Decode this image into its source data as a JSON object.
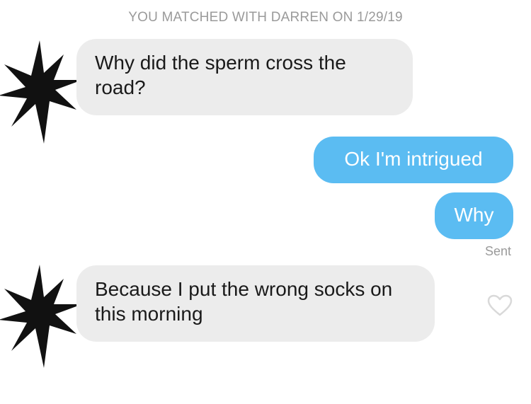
{
  "match_banner": "YOU MATCHED WITH DARREN ON 1/29/19",
  "messages": [
    {
      "direction": "received",
      "text": "Why did the sperm cross the road?"
    },
    {
      "direction": "sent",
      "text": "Ok I'm intrigued"
    },
    {
      "direction": "sent",
      "text": "Why"
    },
    {
      "direction": "received",
      "text": "Because I put the wrong socks on this morning"
    }
  ],
  "status": "Sent",
  "icons": {
    "avatar": "redacted-avatar-icon",
    "like": "heart-outline-icon"
  },
  "colors": {
    "sent_bubble": "#5bbcf2",
    "received_bubble": "#ececec",
    "meta_text": "#9a9a9a"
  }
}
